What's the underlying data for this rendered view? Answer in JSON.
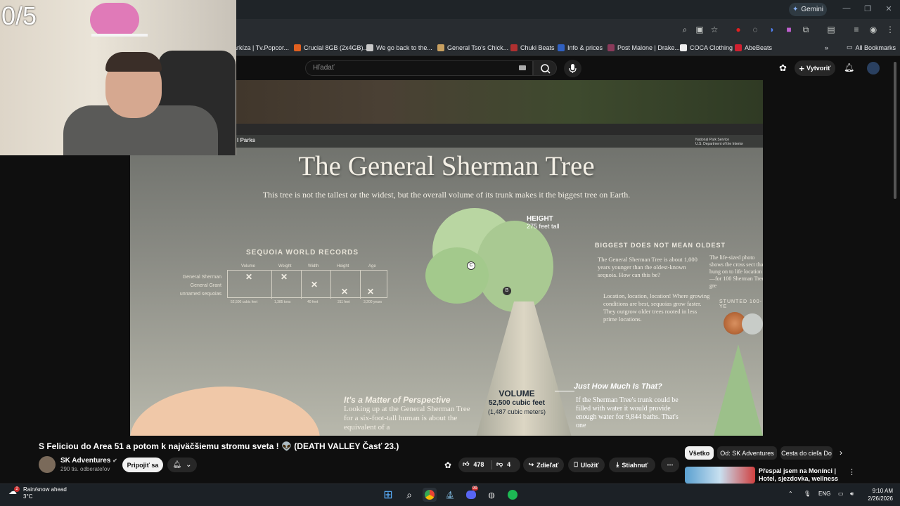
{
  "webcam": {
    "counter": "0/5"
  },
  "browser": {
    "gemini_label": "Gemini",
    "bookmarks": [
      {
        "label": "arkíza | Tv.Popcor...",
        "color": "#9a9a9a"
      },
      {
        "label": "Crucial 8GB (2x4GB)...",
        "color": "#e06020"
      },
      {
        "label": "We go back to the...",
        "color": "#c8c8c8"
      },
      {
        "label": "General Tso's Chick...",
        "color": "#c8a060"
      },
      {
        "label": "Chuki Beats",
        "color": "#b03030"
      },
      {
        "label": "Info & prices",
        "color": "#3060c0"
      },
      {
        "label": "Post Malone | Drake...",
        "color": "#8a3a5a"
      },
      {
        "label": "COCA Clothing",
        "color": "#eeeeee"
      },
      {
        "label": "AbeBeats",
        "color": "#d02030"
      }
    ],
    "all_bookmarks": "All Bookmarks"
  },
  "youtube": {
    "search_placeholder": "Hľadať",
    "create_label": "Vytvoriť"
  },
  "sign": {
    "header_left": "l Parks",
    "nps": [
      "National Park Service",
      "U.S. Department of the Interior"
    ],
    "title": "The General Sherman Tree",
    "subtitle": "This tree is not the tallest or the widest, but the overall volume of its trunk makes it the biggest tree on Earth.",
    "records_title": "SEQUOIA WORLD RECORDS",
    "record_columns": [
      "Volume",
      "Weight",
      "Width",
      "Height",
      "Age"
    ],
    "record_rows": [
      "General Sherman",
      "General Grant",
      "unnamed sequoias"
    ],
    "record_values": [
      "52,500 cubic feet",
      "1,385 tons",
      "40 feet",
      "311 feet",
      "3,200 years"
    ],
    "height_label": "HEIGHT",
    "height_value": "275 feet tall",
    "biggest_title": "BIGGEST DOES NOT MEAN OLDEST",
    "biggest_p1": "The General Sherman Tree is about 1,000 years younger than the oldest-known sequoia. How can this be?",
    "biggest_p2": "Location, location, location! Where growing conditions are best, sequoias grow faster. They outgrow older trees rooted in less prime locations.",
    "lifesize": "The life-sized photo shows the cross sect that hung on to life location—for 100 Sherman Tree gre",
    "stunted": "STUNTED 100-YE",
    "volume_label": "VOLUME",
    "volume_value": "52,500 cubic feet",
    "volume_metric": "(1,487 cubic meters)",
    "howmuch_title": "Just How Much Is That?",
    "howmuch_p": "If the Sherman Tree's trunk could be filled with water it would provide enough water for 9,844 baths. That's one",
    "persp_title": "It's a Matter of Perspective",
    "persp_p": "Looking up at the General Sherman Tree for a six-foot-tall human is about the equivalent of a"
  },
  "video": {
    "title": "S Feliciou do Area 51 a potom k najväčšiemu stromu sveta ! 👽 (DEATH VALLEY Časť 23.)",
    "channel": "SK Adventures",
    "subscribers": "290 tis. odberateľov",
    "join_label": "Pripojiť sa",
    "likes": "478",
    "dislikes": "4",
    "share_label": "Zdieľať",
    "save_label": "Uložiť",
    "download_label": "Stiahnuť"
  },
  "chips": [
    "Všetko",
    "Od: SK Adventures",
    "Cesta do cieľa Do"
  ],
  "recommendation": {
    "title": "Přespal jsem na Monínci | Hotel, sjezdovka, wellness"
  },
  "taskbar": {
    "weather_title": "Rain/snow ahead",
    "weather_temp": "3°C",
    "weather_badge": "2",
    "lang": "ENG",
    "time": "9:10 AM",
    "date": "2/26/2026",
    "discord_badge": "99"
  }
}
